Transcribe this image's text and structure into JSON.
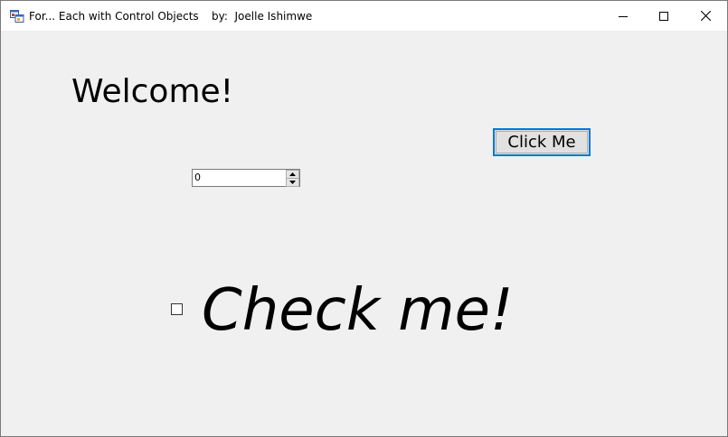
{
  "window": {
    "title": "For... Each with Control Objects",
    "author": "by:  Joelle Ishimwe",
    "icons": {
      "app": "app-form-icon",
      "minimize": "minimize-icon",
      "maximize": "maximize-icon",
      "close": "close-icon"
    },
    "accent_color": "#0078d7"
  },
  "form": {
    "welcome_label": "Welcome!",
    "click_button_label": "Click Me",
    "numeric_value": "0",
    "checkbox_checked": false,
    "checkbox_label": "Check me!"
  }
}
